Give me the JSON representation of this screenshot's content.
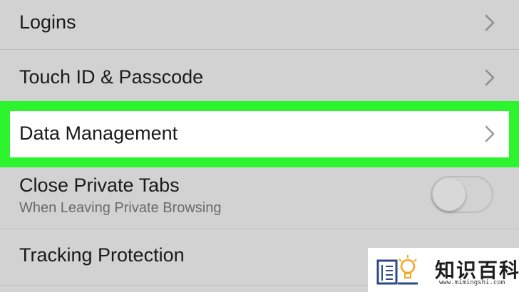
{
  "settings": {
    "rows": [
      {
        "label": "Logins"
      },
      {
        "label": "Touch ID & Passcode"
      },
      {
        "label": "Data Management"
      },
      {
        "label": "Close Private Tabs",
        "sublabel": "When Leaving Private Browsing",
        "toggle_on": false
      },
      {
        "label": "Tracking Protection"
      }
    ]
  },
  "highlight": {
    "color": "#2df52d",
    "target": "Data Management"
  },
  "watermark": {
    "title": "知识百科",
    "url": "www.mimingshi.com"
  },
  "icons": {
    "chevron": "chevron-right-icon",
    "logo": "book-lightbulb-icon"
  }
}
